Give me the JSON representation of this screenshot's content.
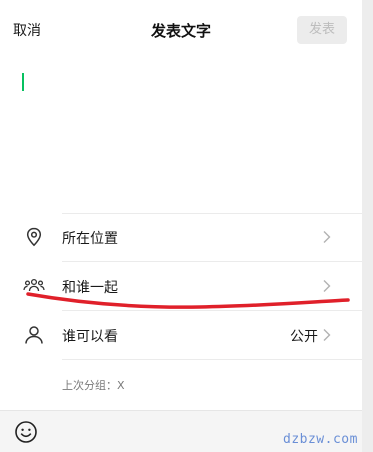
{
  "header": {
    "cancel_label": "取消",
    "title": "发表文字",
    "publish_label": "发表"
  },
  "options": {
    "location": {
      "label": "所在位置",
      "icon": "location-pin-icon"
    },
    "with_whom": {
      "label": "和谁一起",
      "icon": "people-group-icon"
    },
    "visibility": {
      "label": "谁可以看",
      "value": "公开",
      "icon": "person-icon"
    }
  },
  "last_group": "上次分组：X",
  "footer": {
    "icon": "emoji-icon"
  },
  "watermark": "dzbzw.com",
  "colors": {
    "accent": "#07c160",
    "annotation": "#e0202a",
    "disabled_button_bg": "#ececec",
    "disabled_button_text": "#bdbdbd"
  }
}
